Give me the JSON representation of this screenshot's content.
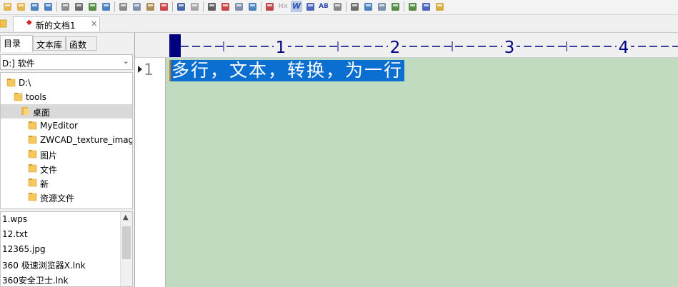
{
  "toolbar": {
    "buttons": [
      {
        "icon": "folder-icon",
        "glyph": ""
      },
      {
        "icon": "open-folder-icon",
        "glyph": ""
      },
      {
        "icon": "save-icon",
        "glyph": ""
      },
      {
        "icon": "save-all-icon",
        "glyph": ""
      },
      {
        "icon": "print-preview-icon",
        "glyph": ""
      },
      {
        "icon": "print-icon",
        "glyph": ""
      },
      {
        "icon": "spellcheck-icon",
        "glyph": ""
      },
      {
        "icon": "export-icon",
        "glyph": ""
      },
      {
        "icon": "cut-icon",
        "glyph": ""
      },
      {
        "icon": "copy-icon",
        "glyph": ""
      },
      {
        "icon": "paste-icon",
        "glyph": ""
      },
      {
        "icon": "delete-icon",
        "glyph": ""
      },
      {
        "icon": "undo-icon",
        "glyph": ""
      },
      {
        "icon": "redo-icon",
        "glyph": ""
      },
      {
        "icon": "find-icon",
        "glyph": ""
      },
      {
        "icon": "replace-icon",
        "glyph": ""
      },
      {
        "icon": "find-next-icon",
        "glyph": ""
      },
      {
        "icon": "insert-icon",
        "glyph": ""
      },
      {
        "icon": "font-icon",
        "glyph": ""
      },
      {
        "icon": "hx-icon",
        "glyph": "Hx"
      },
      {
        "icon": "word-wrap-icon",
        "glyph": "W"
      },
      {
        "icon": "format-list-icon",
        "glyph": ""
      },
      {
        "icon": "abcd-icon",
        "glyph": "AB"
      },
      {
        "icon": "settings-gear-icon",
        "glyph": ""
      },
      {
        "icon": "view-list-icon",
        "glyph": ""
      },
      {
        "icon": "view-panel-icon",
        "glyph": ""
      },
      {
        "icon": "view-doc-icon",
        "glyph": ""
      },
      {
        "icon": "view-export-icon",
        "glyph": ""
      },
      {
        "icon": "bookmark-icon",
        "glyph": ""
      },
      {
        "icon": "help-icon",
        "glyph": ""
      },
      {
        "icon": "plugin-icon",
        "glyph": ""
      }
    ]
  },
  "document_tab": {
    "mark": "◆",
    "title": "新的文档1",
    "close": "✕"
  },
  "panel_tabs": [
    "目录",
    "文本库",
    "函数"
  ],
  "drive": {
    "value": "D:] 软件",
    "arrow": "⌄"
  },
  "tree": [
    {
      "label": "D:\\",
      "indent": 1,
      "selected": false,
      "open": false
    },
    {
      "label": "tools",
      "indent": 2,
      "selected": false,
      "open": false
    },
    {
      "label": "桌面",
      "indent": 3,
      "selected": true,
      "open": true
    },
    {
      "label": "MyEditor",
      "indent": 4,
      "selected": false,
      "open": false
    },
    {
      "label": "ZWCAD_texture_images",
      "indent": 4,
      "selected": false,
      "open": false
    },
    {
      "label": "图片",
      "indent": 4,
      "selected": false,
      "open": false
    },
    {
      "label": "文件",
      "indent": 4,
      "selected": false,
      "open": false
    },
    {
      "label": "新",
      "indent": 4,
      "selected": false,
      "open": false
    },
    {
      "label": "资源文件",
      "indent": 4,
      "selected": false,
      "open": false
    }
  ],
  "files": [
    "1.wps",
    "12.txt",
    "12365.jpg",
    "360 极速浏览器X.lnk",
    "360安全卫士.lnk"
  ],
  "ruler": {
    "numbers": [
      "1",
      "2",
      "3",
      "4"
    ],
    "dash": "—"
  },
  "editor": {
    "line_number": "1",
    "text": "多行，文本，转换，为一行"
  },
  "colors": {
    "editor_bg": "#c1dbc0",
    "selection": "#0b6ed1",
    "ruler_ink": "#000080"
  }
}
